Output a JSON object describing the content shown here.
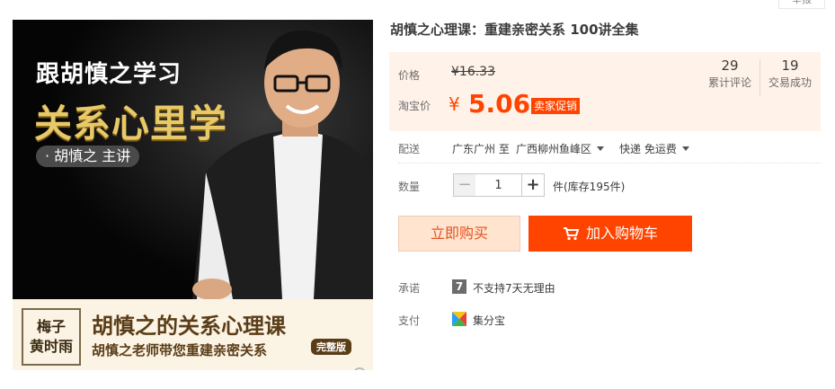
{
  "report_label": "举报",
  "image": {
    "hero_line1": "跟胡慎之学习",
    "hero_line2": "关系心里学",
    "hero_pill": "· 胡慎之 主讲",
    "banner_logo_top": "梅子",
    "banner_logo_bottom": "黄时雨",
    "banner_title": "胡慎之的关系心理课",
    "banner_subtitle": "胡慎之老师带您重建亲密关系",
    "banner_badge": "完整版"
  },
  "product": {
    "title": "胡慎之心理课：重建亲密关系 100讲全集"
  },
  "price": {
    "price_label": "价格",
    "original_price": "¥16.33",
    "taobao_label": "淘宝价",
    "currency_symbol": "¥",
    "current_price": "5.06",
    "promo_tag": "卖家促销"
  },
  "stats": [
    {
      "num": "29",
      "label": "累计评论"
    },
    {
      "num": "19",
      "label": "交易成功"
    }
  ],
  "shipping": {
    "label": "配送",
    "from": "广东广州 至",
    "to": "广西柳州鱼峰区",
    "method": "快递 免运费"
  },
  "quantity": {
    "label": "数量",
    "value": "1",
    "minus": "−",
    "plus": "+",
    "stock": "件(库存195件)"
  },
  "actions": {
    "buy_now": "立即购买",
    "add_to_cart": "加入购物车"
  },
  "promise": {
    "label": "承诺",
    "icon_glyph": "7",
    "text": "不支持7天无理由"
  },
  "payment": {
    "label": "支付",
    "text": "集分宝"
  },
  "colors": {
    "accent": "#ff4400",
    "price_bg": "#fff2e8",
    "buy_now_bg": "#ffe4d0"
  }
}
